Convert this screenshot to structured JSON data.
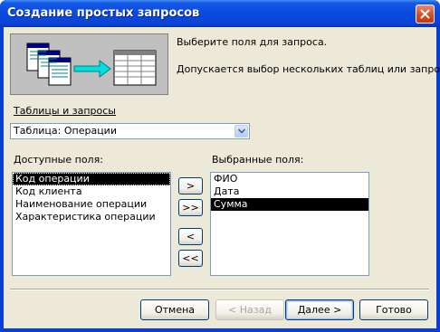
{
  "window": {
    "title": "Создание простых запросов"
  },
  "intro": {
    "line1": "Выберите поля для запроса.",
    "line2": "Допускается выбор нескольких таблиц или запросов."
  },
  "tables": {
    "label": "Таблицы и запросы",
    "selected": "Таблица: Операции"
  },
  "available": {
    "label": "Доступные поля:",
    "items": [
      "Код операции",
      "Код клиента",
      "Наименование операции",
      "Характеристика операции"
    ],
    "selected_index": 0
  },
  "chosen": {
    "label": "Выбранные поля:",
    "items": [
      "ФИО",
      "Дата",
      "Сумма"
    ],
    "selected_index": 2
  },
  "move_buttons": {
    "add": ">",
    "add_all": ">>",
    "remove": "<",
    "remove_all": "<<"
  },
  "footer": {
    "cancel": "Отмена",
    "back": "< Назад",
    "next": "Далее >",
    "finish": "Готово"
  },
  "colors": {
    "title_bar": "#0a4ae0",
    "dialog_bg": "#ece9d8",
    "selection": "#000000",
    "illustration_arrow": "#00e0e0"
  }
}
